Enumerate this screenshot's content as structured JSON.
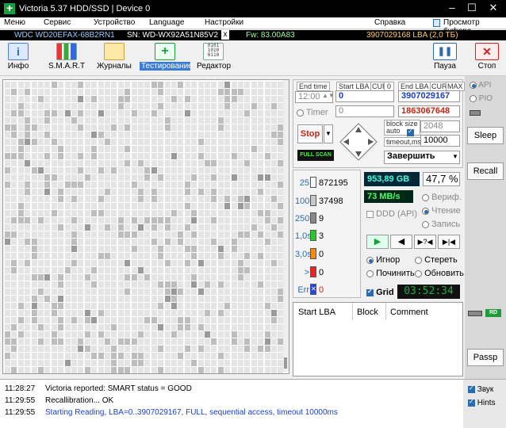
{
  "window": {
    "title": "Victoria 5.37 HDD/SSD | Device 0"
  },
  "menu": {
    "items": [
      "Меню",
      "Сервис",
      "Устройство",
      "Language",
      "Настройки",
      "Справка"
    ],
    "clipboard": "Просмотр буфера"
  },
  "infobar": {
    "model": "WDC WD20EFAX-68B2RN1",
    "serial": "SN: WD-WX92A51N85V2",
    "close": "x",
    "firmware": "Fw: 83.00A83",
    "lba": "3907029168 LBA (2,0 ТБ)"
  },
  "toolbar": {
    "info": "Инфо",
    "smart": "S.M.A.R.T",
    "logs": "Журналы",
    "test": "Тестирование",
    "editor": "Редактор",
    "pause": "Пауза",
    "stop": "Стоп"
  },
  "scan": {
    "end_time_label": "End time",
    "end_time_value": "12:00",
    "timer_label": "Timer",
    "timer_value": "0",
    "start_lba_label": "Start LBA",
    "start_lba_value": "0",
    "start_cur": "CUR",
    "start_cur_val": "0",
    "end_lba_label": "End LBA",
    "end_cur": "CUR",
    "end_max": "MAX",
    "end_lba_value": "3907029167",
    "current_lba": "1863067648",
    "stop_label": "Stop",
    "full_scan": "FULL SCAN",
    "block_size_label": "block size",
    "auto_label": "auto",
    "block_size_value": "2048",
    "timeout_label": "timeout,ms",
    "timeout_value": "10000",
    "finish_action": "Завершить"
  },
  "legend": [
    {
      "label": "25",
      "count": "872195",
      "color": "#f7f7f7"
    },
    {
      "label": "100",
      "count": "37498",
      "color": "#c8c8c8"
    },
    {
      "label": "250",
      "count": "9",
      "color": "#888888"
    },
    {
      "label": "1,0s",
      "count": "3",
      "color": "#22cc22"
    },
    {
      "label": "3,0s",
      "count": "0",
      "color": "#ff8800"
    },
    {
      "label": ">",
      "count": "0",
      "color": "#ee2222"
    },
    {
      "label": "Err",
      "count": "0",
      "color": "#2244ee"
    }
  ],
  "stats": {
    "processed": "953,89 GB",
    "percent": "47,7",
    "percent_unit": "%",
    "speed": "73 MB/s",
    "verify": "Вериф.",
    "read": "Чтение",
    "write": "Запись",
    "ddd": "DDD (API)"
  },
  "actions": {
    "ignore": "Игнор",
    "erase": "Стереть",
    "repair": "Починить",
    "refresh": "Обновить"
  },
  "grid": {
    "label": "Grid",
    "time": "03:52:34"
  },
  "table": {
    "headers": [
      "Start LBA",
      "Block",
      "Comment"
    ]
  },
  "right": {
    "api": "API",
    "pio": "PIO",
    "sleep": "Sleep",
    "recall": "Recall",
    "rd": "RD",
    "passp": "Passp",
    "sound": "Звук",
    "hints": "Hints"
  },
  "log": [
    {
      "time": "11:28:27",
      "msg": "Victoria reported: SMART status = GOOD",
      "color": "#000000"
    },
    {
      "time": "11:29:55",
      "msg": "Recallibration... OK",
      "color": "#000000"
    },
    {
      "time": "11:29:55",
      "msg": "Starting Reading, LBA=0..3907029167, FULL, sequential access, timeout 10000ms",
      "color": "#1a3fc8"
    }
  ]
}
